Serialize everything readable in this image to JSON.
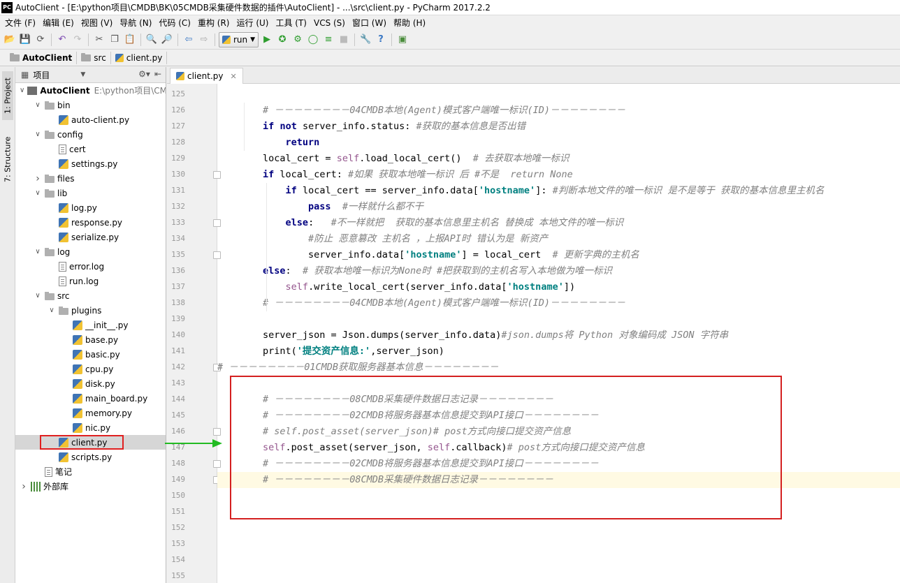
{
  "window": {
    "app_logo": "PC",
    "title": "AutoClient - [E:\\python项目\\CMDB\\BK\\05CMDB采集硬件数据的插件\\AutoClient] - ...\\src\\client.py - PyCharm 2017.2.2"
  },
  "menu": [
    "文件 (F)",
    "编辑 (E)",
    "视图 (V)",
    "导航 (N)",
    "代码 (C)",
    "重构 (R)",
    "运行 (U)",
    "工具 (T)",
    "VCS (S)",
    "窗口 (W)",
    "帮助 (H)"
  ],
  "toolbar": {
    "run_config": "run"
  },
  "breadcrumb": [
    "AutoClient",
    "src",
    "client.py"
  ],
  "side_tabs": {
    "project": "1: Project",
    "structure": "7: Structure"
  },
  "project_panel": {
    "header": "项目",
    "root_name": "AutoClient",
    "root_path": "E:\\python项目\\CM",
    "tree": [
      {
        "label": "bin",
        "type": "folder",
        "depth": 1,
        "open": true
      },
      {
        "label": "auto-client.py",
        "type": "py",
        "depth": 2
      },
      {
        "label": "config",
        "type": "folder",
        "depth": 1,
        "open": true
      },
      {
        "label": "cert",
        "type": "file",
        "depth": 2
      },
      {
        "label": "settings.py",
        "type": "py",
        "depth": 2
      },
      {
        "label": "files",
        "type": "folder",
        "depth": 1,
        "open": false
      },
      {
        "label": "lib",
        "type": "folder",
        "depth": 1,
        "open": true
      },
      {
        "label": "log.py",
        "type": "py",
        "depth": 2
      },
      {
        "label": "response.py",
        "type": "py",
        "depth": 2
      },
      {
        "label": "serialize.py",
        "type": "py",
        "depth": 2
      },
      {
        "label": "log",
        "type": "folder",
        "depth": 1,
        "open": true
      },
      {
        "label": "error.log",
        "type": "file",
        "depth": 2
      },
      {
        "label": "run.log",
        "type": "file",
        "depth": 2
      },
      {
        "label": "src",
        "type": "folder",
        "depth": 1,
        "open": true
      },
      {
        "label": "plugins",
        "type": "folder",
        "depth": 2,
        "open": true
      },
      {
        "label": "__init__.py",
        "type": "py",
        "depth": 3
      },
      {
        "label": "base.py",
        "type": "py",
        "depth": 3
      },
      {
        "label": "basic.py",
        "type": "py",
        "depth": 3
      },
      {
        "label": "cpu.py",
        "type": "py",
        "depth": 3
      },
      {
        "label": "disk.py",
        "type": "py",
        "depth": 3
      },
      {
        "label": "main_board.py",
        "type": "py",
        "depth": 3
      },
      {
        "label": "memory.py",
        "type": "py",
        "depth": 3
      },
      {
        "label": "nic.py",
        "type": "py",
        "depth": 3
      },
      {
        "label": "client.py",
        "type": "py",
        "depth": 2,
        "selected": true
      },
      {
        "label": "scripts.py",
        "type": "py",
        "depth": 2
      },
      {
        "label": "笔记",
        "type": "file",
        "depth": 1
      },
      {
        "label": "外部库",
        "type": "lib",
        "depth": 0,
        "open": false
      }
    ]
  },
  "editor": {
    "tab_label": "client.py",
    "first_line_number": 125,
    "current_line": 149,
    "lines": [
      "",
      "        # －－－－－－－－04CMDB本地(Agent)模式客户端唯一标识(ID)－－－－－－－－",
      "        if not server_info.status: #获取的基本信息是否出错",
      "            return",
      "        local_cert = self.load_local_cert()  # 去获取本地唯一标识",
      "        if local_cert: #如果 获取本地唯一标识 后 #不是  return None",
      "            if local_cert == server_info.data['hostname']: #判断本地文件的唯一标识 是不是等于 获取的基本信息里主机名",
      "                pass  #一样就什么都不干",
      "            else:   #不一样就把  获取的基本信息里主机名 替换成 本地文件的唯一标识",
      "                #防止 恶意篡改 主机名 ，上报API时 错认为是 新资产",
      "                server_info.data['hostname'] = local_cert  # 更新字典的主机名",
      "        else:  # 获取本地唯一标识为None时 #把获取到的主机名写入本地做为唯一标识",
      "            self.write_local_cert(server_info.data['hostname'])",
      "        # －－－－－－－－04CMDB本地(Agent)模式客户端唯一标识(ID)－－－－－－－－",
      "",
      "        server_json = Json.dumps(server_info.data)#json.dumps将 Python 对象编码成 JSON 字符串",
      "        print('提交资产信息:',server_json)",
      "# －－－－－－－－01CMDB获取服务器基本信息－－－－－－－－",
      "",
      "        # －－－－－－－－08CMDB采集硬件数据日志记录－－－－－－－－",
      "        # －－－－－－－－02CMDB将服务器基本信息提交到API接口－－－－－－－－",
      "        # self.post_asset(server_json)# post方式向接口提交资产信息",
      "        self.post_asset(server_json, self.callback)# post方式向接口提交资产信息",
      "        # －－－－－－－－02CMDB将服务器基本信息提交到API接口－－－－－－－－",
      "        # －－－－－－－－08CMDB采集硬件数据日志记录－－－－－－－－",
      "",
      "",
      "",
      "",
      "",
      ""
    ]
  },
  "colors": {
    "annotation_red": "#d42020",
    "annotation_arrow": "#22bb22",
    "keyword": "#000080",
    "comment": "#808080",
    "string": "#008080",
    "self": "#94558d"
  }
}
